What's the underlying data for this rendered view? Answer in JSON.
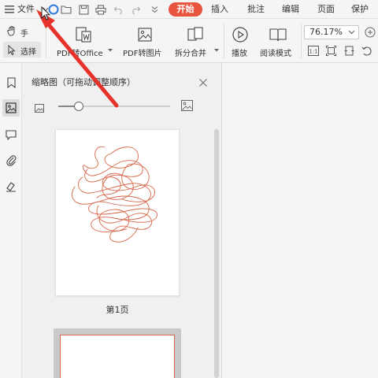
{
  "menubar": {
    "file_label": "文件",
    "tabs": [
      {
        "label": "开始",
        "active": true
      },
      {
        "label": "插入"
      },
      {
        "label": "批注"
      },
      {
        "label": "编辑"
      },
      {
        "label": "页面"
      },
      {
        "label": "保护"
      }
    ]
  },
  "toolbar": {
    "hand_label": "手",
    "select_label": "选择",
    "pdf_to_office_label": "PDF转Office",
    "pdf_to_image_label": "PDF转图片",
    "split_merge_label": "拆分合并",
    "play_label": "播放",
    "read_mode_label": "阅读模式",
    "zoom_value": "76.17%",
    "actual_size_label": "1:1"
  },
  "thumbnail_panel": {
    "title": "缩略图（可拖动调整顺序）",
    "pages": [
      {
        "label": "第1页"
      }
    ],
    "size_slider_fraction": 0.18
  },
  "colors": {
    "accent": "#e8543d",
    "scribble": "#d8664a",
    "arrow": "#e6322b"
  },
  "icons": {
    "menu": "hamburger-icon",
    "file_open": "folder-icon",
    "save": "save-icon",
    "print": "printer-icon",
    "undo": "undo-icon",
    "redo": "redo-icon"
  }
}
